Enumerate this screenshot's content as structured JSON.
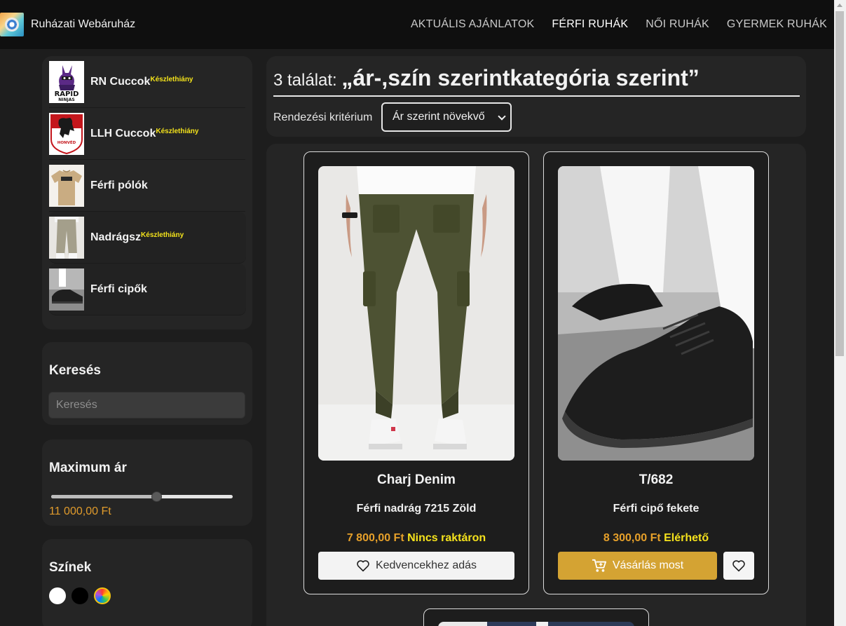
{
  "brand": {
    "name": "Ruházati Webáruház"
  },
  "nav": [
    {
      "label": "AKTUÁLIS AJÁNLATOK",
      "active": false
    },
    {
      "label": "FÉRFI RUHÁK",
      "active": true
    },
    {
      "label": "NŐI RUHÁK",
      "active": false
    },
    {
      "label": "GYERMEK RUHÁK",
      "active": false
    }
  ],
  "sidebar": {
    "categories": [
      {
        "label": "RN Cuccok",
        "badge": "Készlethiány",
        "icon": "rapid-ninjas-logo"
      },
      {
        "label": "LLH Cuccok",
        "badge": "Készlethiány",
        "icon": "honved-crest"
      },
      {
        "label": "Férfi pólók",
        "badge": "",
        "icon": "tshirt-photo"
      },
      {
        "label": "Nadrágsz",
        "badge": "Készlethiány",
        "icon": "trousers-photo"
      },
      {
        "label": "Férfi cipők",
        "badge": "",
        "icon": "shoes-photo"
      }
    ],
    "search": {
      "title": "Keresés",
      "placeholder": "Keresés"
    },
    "price": {
      "title": "Maximum ár",
      "value_label": "11 000,00 Ft",
      "slider_fraction": 0.58
    },
    "colors": {
      "title": "Színek",
      "swatches": [
        "#ffffff",
        "#000000",
        "rainbow"
      ]
    }
  },
  "results": {
    "count_text": "3 találat:",
    "query_text": "„ár-,szín szerintkategória szerint”",
    "sort_label": "Rendezési kritérium",
    "sort_value": "Ár szerint növekvő"
  },
  "products": [
    {
      "name": "Charj Denim",
      "desc": "Férfi nadrág 7215 Zöld",
      "price": "7 800,00 Ft",
      "stock": "Nincs raktáron",
      "fav_label": "Kedvencekhez adás"
    },
    {
      "name": "T/682",
      "desc": "Férfi cipő fekete",
      "price": "8 300,00 Ft",
      "stock": "Elérhető",
      "buy_label": "Vásárlás most"
    }
  ],
  "colors": {
    "accent": "#d4a333",
    "price": "#e6a02a",
    "stock": "#f5e21c",
    "background": "#1d1d1d"
  }
}
